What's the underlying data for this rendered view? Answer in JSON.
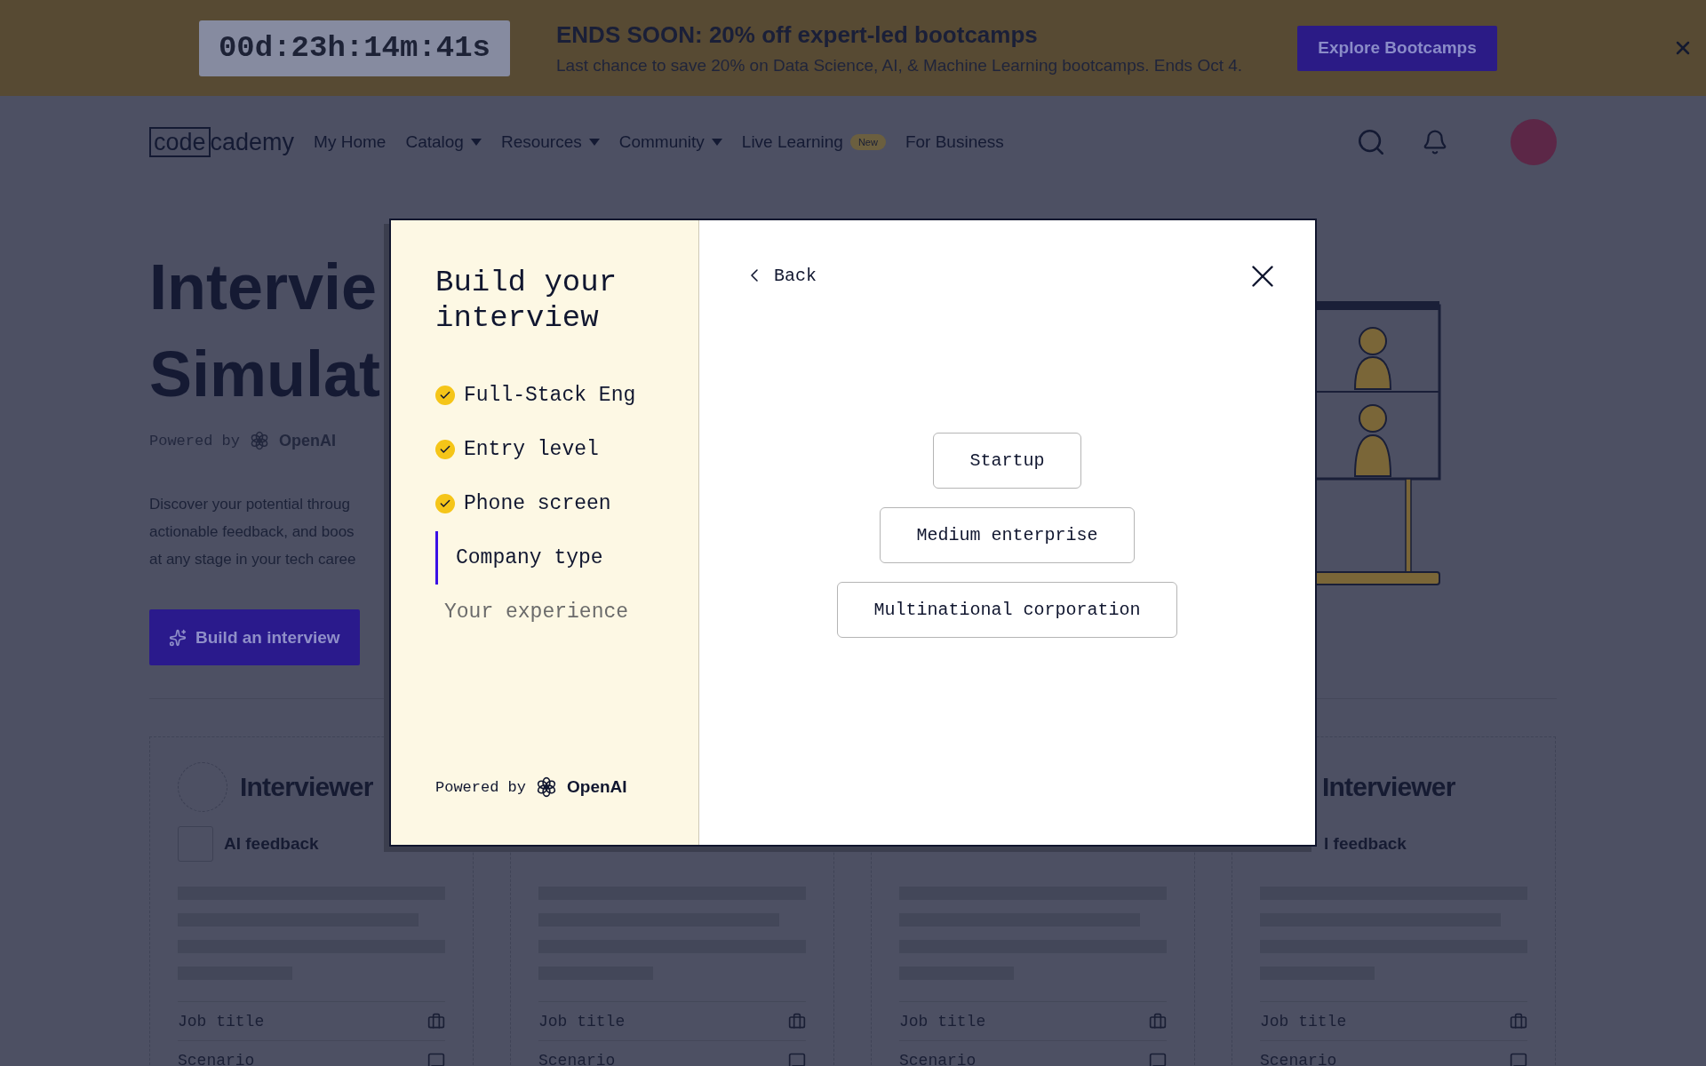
{
  "banner": {
    "timer": "00d:23h:14m:41s",
    "title": "ENDS SOON: 20% off expert-led bootcamps",
    "text": "Last chance to save 20% on Data Science, AI, & Machine Learning bootcamps. Ends Oct 4.",
    "button": "Explore Bootcamps"
  },
  "nav": {
    "logo_boxed": "code",
    "logo_rest": "cademy",
    "items": [
      {
        "label": "My Home",
        "kind": "link"
      },
      {
        "label": "Catalog",
        "kind": "dropdown"
      },
      {
        "label": "Resources",
        "kind": "dropdown"
      },
      {
        "label": "Community",
        "kind": "dropdown"
      },
      {
        "label": "Live Learning",
        "kind": "badge",
        "badge": "New"
      },
      {
        "label": "For Business",
        "kind": "link"
      }
    ]
  },
  "hero": {
    "title_lines": [
      "Intervie",
      "Simulat"
    ],
    "powered_by": "Powered by",
    "brand": "OpenAI",
    "description_lines": [
      "Discover your potential throug",
      "actionable feedback, and boos",
      "at any stage in your tech caree"
    ],
    "button": "Build an interview"
  },
  "cards": [
    {
      "avatar": true,
      "title": "Interviewer",
      "feedback_icon": true,
      "feedback": "AI feedback",
      "rows": [
        "Job title",
        "Scenario"
      ]
    },
    {
      "avatar": false,
      "feedback_icon": false,
      "rows": [
        "Job title",
        "Scenario"
      ]
    },
    {
      "avatar": false,
      "feedback_icon": false,
      "rows": [
        "Job title",
        "Scenario"
      ]
    },
    {
      "avatar": false,
      "title": "Interviewer",
      "feedback_icon": false,
      "feedback": "I feedback",
      "rows": [
        "Job title",
        "Scenario"
      ]
    }
  ],
  "modal": {
    "title": "Build your interview",
    "steps": [
      {
        "label": "Full-Stack Eng",
        "checked": true,
        "selected": false
      },
      {
        "label": "Entry level",
        "checked": true,
        "selected": false
      },
      {
        "label": "Phone screen",
        "checked": true,
        "selected": false
      },
      {
        "label": "Company type",
        "checked": false,
        "selected": true
      },
      {
        "label": "Your experience",
        "checked": false,
        "selected": false
      }
    ],
    "powered_by": "Powered by",
    "brand": "OpenAI",
    "back": "Back",
    "options": [
      "Startup",
      "Medium enterprise",
      "Multinational corporation"
    ]
  }
}
